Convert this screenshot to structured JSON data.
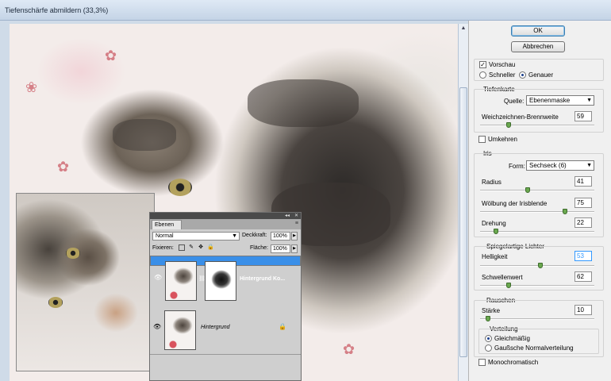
{
  "window": {
    "title": "Tiefenschärfe abmildern (33,3%)"
  },
  "layers_panel": {
    "tab": "Ebenen",
    "blend_mode": "Normal",
    "opacity_label": "Deckkraft:",
    "opacity_value": "100%",
    "lock_label": "Fixieren:",
    "fill_label": "Fläche:",
    "fill_value": "100%",
    "layers": [
      {
        "name": "Hintergrund Ko...",
        "selected": true
      },
      {
        "name": "Hintergrund",
        "selected": false
      }
    ]
  },
  "controls": {
    "ok": "OK",
    "cancel": "Abbrechen",
    "preview": "Vorschau",
    "fast": "Schneller",
    "accurate": "Genauer",
    "depth_map": {
      "title": "Tiefenkarte",
      "source_label": "Quelle:",
      "source_value": "Ebenenmaske",
      "focus_label": "Weichzeichnen-Brennweite",
      "focus_value": "59",
      "focus_level": 0.24,
      "invert": "Umkehren"
    },
    "iris": {
      "title": "Iris",
      "shape_label": "Form:",
      "shape_value": "Sechseck (6)",
      "radius_label": "Radius",
      "radius_value": "41",
      "radius_level": 0.41,
      "curvature_label": "Wölbung der Irisblende",
      "curvature_value": "75",
      "curvature_level": 0.75,
      "rotation_label": "Drehung",
      "rotation_value": "22",
      "rotation_level": 0.12
    },
    "specular": {
      "title": "Spiegelartige Lichter",
      "brightness_label": "Helligkeit",
      "brightness_value": "53",
      "brightness_level": 0.53,
      "threshold_label": "Schwellenwert",
      "threshold_value": "62",
      "threshold_level": 0.24
    },
    "noise": {
      "title": "Rauschen",
      "amount_label": "Stärke",
      "amount_value": "10",
      "amount_level": 0.05,
      "distribution_title": "Verteilung",
      "uniform": "Gleichmäßig",
      "gaussian": "Gaußsche Normalverteilung",
      "monochrome": "Monochromatisch"
    }
  }
}
